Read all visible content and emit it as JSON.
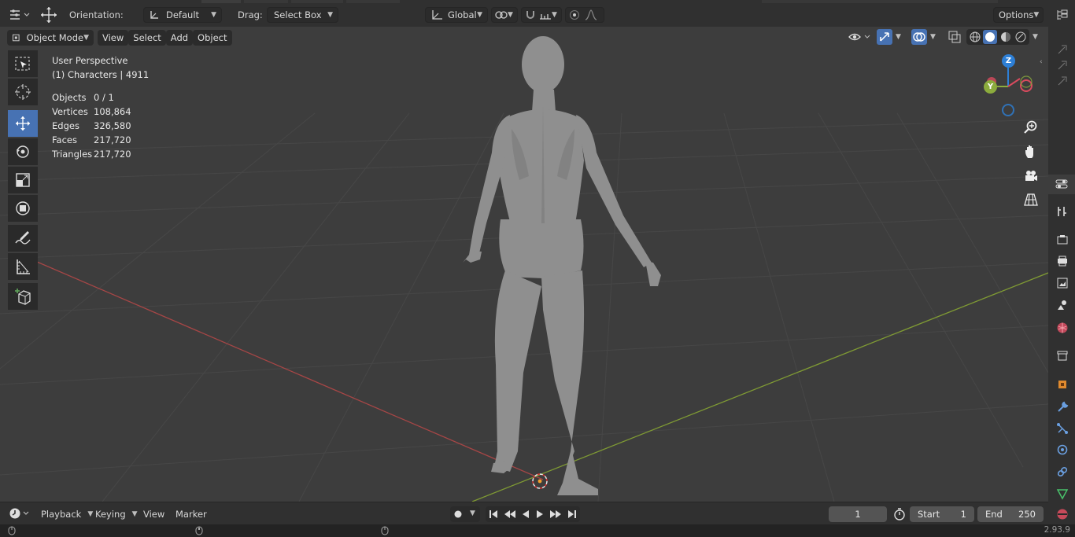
{
  "header": {
    "orientation_label": "Orientation:",
    "orientation_value": "Default",
    "drag_label": "Drag:",
    "drag_value": "Select Box",
    "transform_space": "Global",
    "options_label": "Options"
  },
  "viewport_header": {
    "mode": "Object Mode",
    "menus": [
      "View",
      "Select",
      "Add",
      "Object"
    ]
  },
  "overlay": {
    "perspective": "User Perspective",
    "collection": "(1) Characters | 4911",
    "stats": [
      {
        "label": "Objects",
        "value": "0 / 1"
      },
      {
        "label": "Vertices",
        "value": "108,864"
      },
      {
        "label": "Edges",
        "value": "326,580"
      },
      {
        "label": "Faces",
        "value": "217,720"
      },
      {
        "label": "Triangles",
        "value": "217,720"
      }
    ]
  },
  "gizmo": {
    "z": "Z",
    "y": "Y"
  },
  "toolbar": {
    "tools": [
      "select-box",
      "cursor",
      "move",
      "rotate",
      "scale",
      "transform",
      "annotate",
      "measure",
      "add-cube"
    ],
    "active": "move"
  },
  "timeline": {
    "menus": [
      "Playback",
      "Keying",
      "View",
      "Marker"
    ],
    "current_frame": "1",
    "start_label": "Start",
    "start_value": "1",
    "end_label": "End",
    "end_value": "250"
  },
  "status": {
    "version": "2.93.9"
  },
  "colors": {
    "accent": "#4772b3",
    "x_axis": "#b34c4c",
    "y_axis": "#8cac3d",
    "z_axis": "#2d7fd6",
    "viewport_bg": "#3d3d3d"
  }
}
